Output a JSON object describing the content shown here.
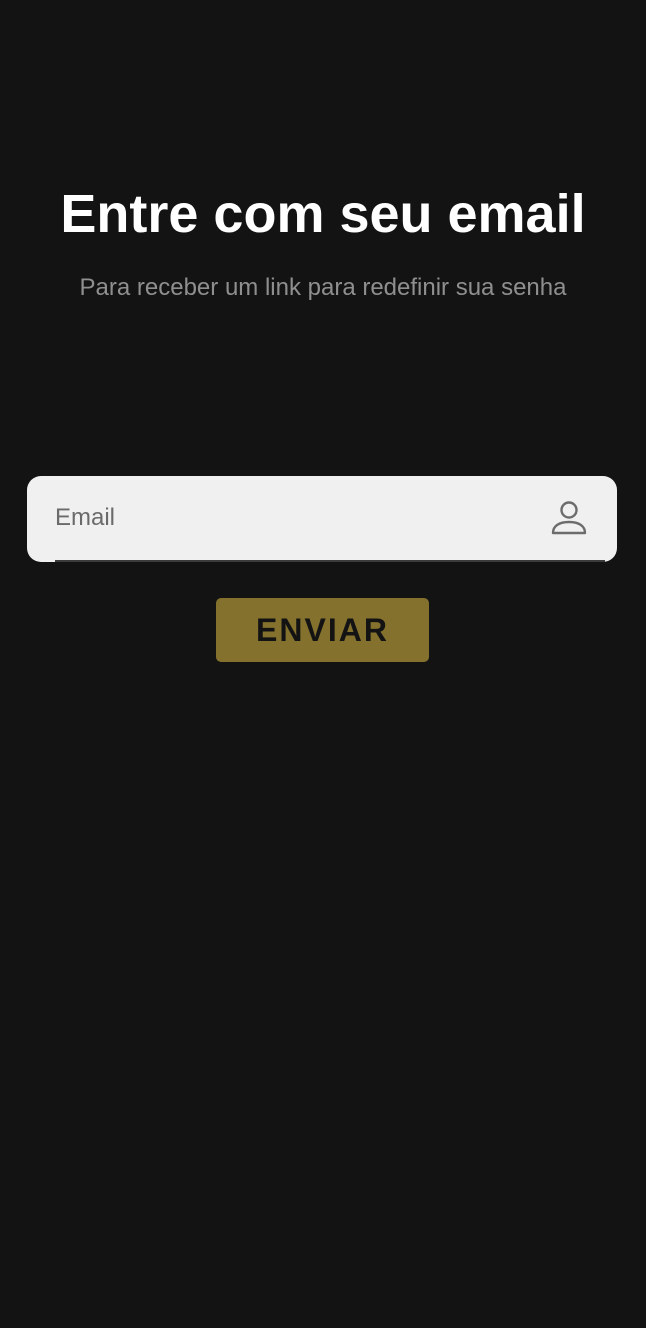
{
  "header": {
    "title": "Entre com seu email",
    "subtitle": "Para receber um link para redefinir sua senha"
  },
  "form": {
    "email": {
      "value": "",
      "placeholder": "Email",
      "icon": "user-icon"
    },
    "submit_label": "ENVIAR"
  },
  "colors": {
    "background": "#131313",
    "title": "#ffffff",
    "subtitle": "#8f8f8f",
    "input_background": "#f0f0f0",
    "button_background": "#83712d",
    "button_text": "#131313"
  }
}
